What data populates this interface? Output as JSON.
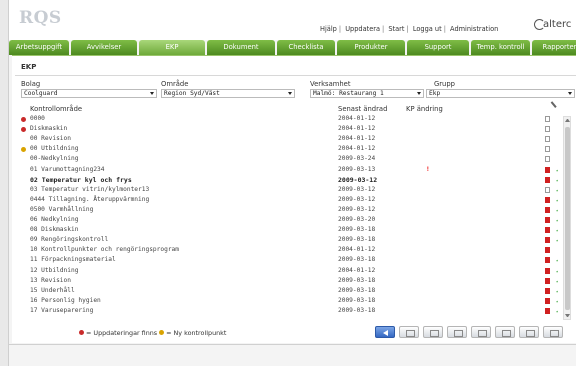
{
  "header": {
    "logo": "RQS",
    "brand": "alterc",
    "links": [
      "Hjälp",
      "Uppdatera",
      "Start",
      "Logga ut",
      "Administration"
    ]
  },
  "nav": {
    "tabs": [
      {
        "label": "Arbetsuppgift",
        "active": false
      },
      {
        "label": "Avvikelser",
        "active": false
      },
      {
        "label": "EKP",
        "active": true
      },
      {
        "label": "Dokument",
        "active": false
      },
      {
        "label": "Checklista",
        "active": false
      },
      {
        "label": "Produkter",
        "active": false
      },
      {
        "label": "Support",
        "active": false
      },
      {
        "label": "Temp. kontroll",
        "active": false
      },
      {
        "label": "Rapporter",
        "active": false
      }
    ]
  },
  "page": {
    "title": "EKP"
  },
  "filters": {
    "bolag": {
      "label": "Bolag",
      "value": "Coolguard"
    },
    "omrade": {
      "label": "Område",
      "value": "Region Syd/Väst"
    },
    "verksamhet": {
      "label": "Verksamhet",
      "value": "Malmö: Restaurang 1"
    },
    "grupp": {
      "label": "Grupp",
      "value": "Ekp"
    }
  },
  "table": {
    "headers": {
      "name": "Kontrollområde",
      "date": "Senast ändrad",
      "change": "KP ändring"
    },
    "rows": [
      {
        "name": "0000",
        "date": "2004-01-12",
        "status": "red",
        "change": "",
        "pdf": "empty",
        "result": "-",
        "bold": false
      },
      {
        "name": "Diskmaskin",
        "date": "2004-01-12",
        "status": "red",
        "change": "",
        "pdf": "empty",
        "result": "-",
        "bold": false
      },
      {
        "name": "00 Revision",
        "date": "2004-01-12",
        "status": "",
        "change": "",
        "pdf": "empty",
        "result": "-",
        "bold": false
      },
      {
        "name": "00 Utbildning",
        "date": "2004-01-12",
        "status": "yellow",
        "change": "",
        "pdf": "empty",
        "result": "-",
        "bold": false
      },
      {
        "name": "00-Nedkylning",
        "date": "2009-03-24",
        "status": "",
        "change": "",
        "pdf": "empty",
        "result": "-",
        "bold": false
      },
      {
        "name": "01 Varumottagning234",
        "date": "2009-03-13",
        "status": "",
        "change": "!",
        "pdf": "red",
        "result": "check",
        "bold": false
      },
      {
        "name": "02 Temperatur kyl och frys",
        "date": "2009-03-12",
        "status": "",
        "change": "",
        "pdf": "red",
        "result": "check",
        "bold": true
      },
      {
        "name": "03 Temperatur vitrin/kylmonter13",
        "date": "2009-03-12",
        "status": "",
        "change": "",
        "pdf": "empty",
        "result": "check",
        "bold": false
      },
      {
        "name": "0444 Tillagning. Återuppvärmning",
        "date": "2009-03-12",
        "status": "",
        "change": "",
        "pdf": "red",
        "result": "check",
        "bold": false
      },
      {
        "name": "0500 Varmhållning",
        "date": "2009-03-12",
        "status": "",
        "change": "",
        "pdf": "red",
        "result": "check",
        "bold": false
      },
      {
        "name": "06 Nedkylning",
        "date": "2009-03-20",
        "status": "",
        "change": "",
        "pdf": "red",
        "result": "check",
        "bold": false
      },
      {
        "name": "08 Diskmaskin",
        "date": "2009-03-18",
        "status": "",
        "change": "",
        "pdf": "red",
        "result": "check",
        "bold": false
      },
      {
        "name": "09 Rengöringskontroll",
        "date": "2009-03-18",
        "status": "",
        "change": "",
        "pdf": "red",
        "result": "check",
        "bold": false
      },
      {
        "name": "10 Kontrollpunkter och rengöringsprogram",
        "date": "2004-01-12",
        "status": "",
        "change": "",
        "pdf": "red",
        "result": "-",
        "bold": false
      },
      {
        "name": "11 Förpackningsmaterial",
        "date": "2009-03-18",
        "status": "",
        "change": "",
        "pdf": "red",
        "result": "check",
        "bold": false
      },
      {
        "name": "12 Utbildning",
        "date": "2004-01-12",
        "status": "",
        "change": "",
        "pdf": "red",
        "result": "check",
        "bold": false
      },
      {
        "name": "13 Revision",
        "date": "2009-03-18",
        "status": "",
        "change": "",
        "pdf": "red",
        "result": "check",
        "bold": false
      },
      {
        "name": "15 Underhåll",
        "date": "2009-03-18",
        "status": "",
        "change": "",
        "pdf": "red",
        "result": "check",
        "bold": false
      },
      {
        "name": "16 Personlig hygien",
        "date": "2009-03-18",
        "status": "",
        "change": "",
        "pdf": "red",
        "result": "check",
        "bold": false
      },
      {
        "name": "17 Varuseparering",
        "date": "2009-03-18",
        "status": "",
        "change": "",
        "pdf": "red",
        "result": "check",
        "bold": false
      }
    ]
  },
  "legend": {
    "updates": "= Uppdateringar finns",
    "new_point": "= Ny kontrollpunkt"
  },
  "toolbar": {
    "icons": [
      "back-icon",
      "blank-page-icon",
      "edit-page-icon",
      "network-icon",
      "list-icon",
      "document-list-icon",
      "pdf-document-icon",
      "delete-page-icon"
    ]
  },
  "colors": {
    "nav_green": "#5e9b2a",
    "nav_active": "#8bc35a",
    "status_red": "#c92a2a",
    "status_yellow": "#d9a300",
    "pdf_red": "#d02020",
    "check_green": "#1e9a1e"
  }
}
